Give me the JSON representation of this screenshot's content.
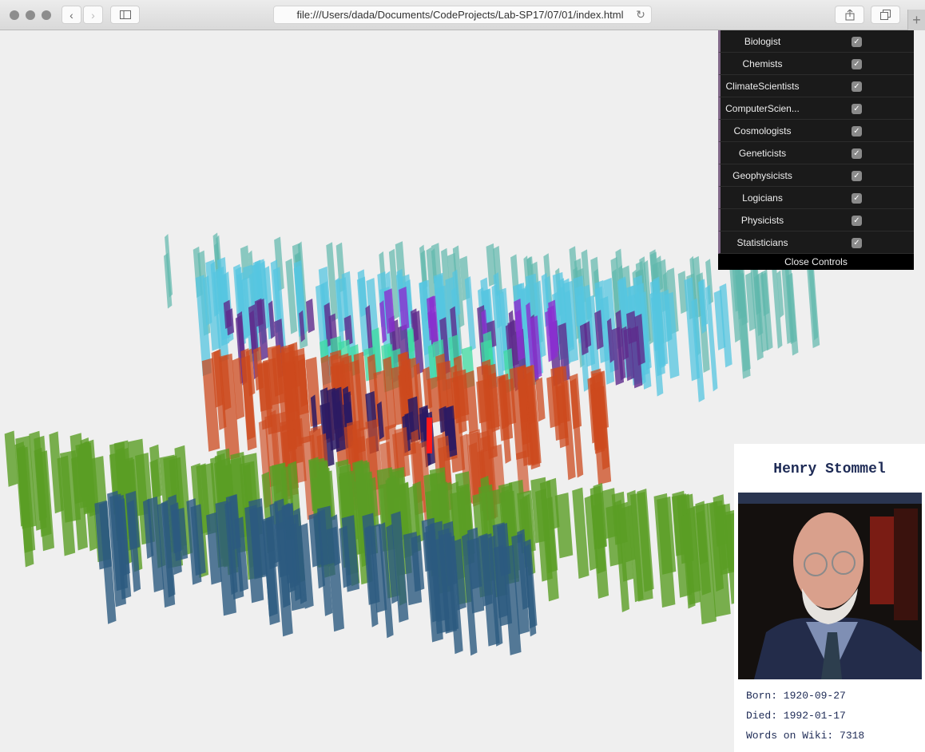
{
  "browser": {
    "url": "file:///Users/dada/Documents/CodeProjects/Lab-SP17/07/01/index.html",
    "icons": [
      "close-dot",
      "minimize-dot",
      "zoom-dot",
      "back-icon",
      "forward-icon",
      "sidebar-icon",
      "reload-icon",
      "share-icon",
      "tabs-icon",
      "new-tab-icon"
    ]
  },
  "controls": {
    "items": [
      {
        "label": "Biologist",
        "checked": true
      },
      {
        "label": "Chemists",
        "checked": true
      },
      {
        "label": "ClimateScientists",
        "checked": true
      },
      {
        "label": "ComputerScien...",
        "checked": true
      },
      {
        "label": "Cosmologists",
        "checked": true
      },
      {
        "label": "Geneticists",
        "checked": true
      },
      {
        "label": "Geophysicists",
        "checked": true
      },
      {
        "label": "Logicians",
        "checked": true
      },
      {
        "label": "Physicists",
        "checked": true
      },
      {
        "label": "Statisticians",
        "checked": true
      }
    ],
    "close_label": "Close Controls",
    "check_glyph": "✓"
  },
  "info_card": {
    "name": "Henry Stommel",
    "born": "Born: 1920-09-27",
    "died": "Died: 1992-01-17",
    "words": "Words on Wiki: 7318",
    "photo_alt": "portrait-photo"
  },
  "scene": {
    "groups": [
      {
        "name": "teal-band",
        "color": "#5fb8ad"
      },
      {
        "name": "cyan-band",
        "color": "#56c6e0"
      },
      {
        "name": "purple-band",
        "color": "#5e2a8c"
      },
      {
        "name": "violet-band",
        "color": "#8a2fd0"
      },
      {
        "name": "mint-band",
        "color": "#3ddba0"
      },
      {
        "name": "orange-band",
        "color": "#cc4a1e"
      },
      {
        "name": "navy-band",
        "color": "#2b1a63"
      },
      {
        "name": "green-band",
        "color": "#5a9e24"
      },
      {
        "name": "blue-band",
        "color": "#2c5a80"
      }
    ],
    "highlight_color": "#ff1a1a"
  }
}
